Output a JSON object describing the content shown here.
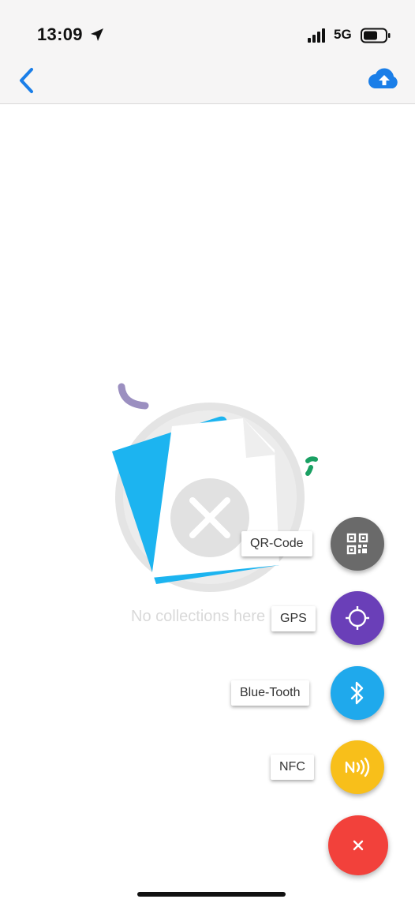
{
  "status_bar": {
    "time": "13:09",
    "network": "5G"
  },
  "nav": {
    "back_icon": "chevron-left-icon",
    "upload_icon": "cloud-upload-icon",
    "accent": "#1a7ee8"
  },
  "empty_state": {
    "message": "No collections here"
  },
  "speed_dial": {
    "items": [
      {
        "label": "QR-Code",
        "icon": "qr-code-icon",
        "color": "#6a6a6a"
      },
      {
        "label": "GPS",
        "icon": "gps-crosshair-icon",
        "color": "#6a3fb8"
      },
      {
        "label": "Blue-Tooth",
        "icon": "bluetooth-icon",
        "color": "#1fa9ec"
      },
      {
        "label": "NFC",
        "icon": "nfc-icon",
        "color": "#f8bf1a"
      }
    ],
    "close_icon": "close-icon",
    "close_color": "#f2413b"
  }
}
